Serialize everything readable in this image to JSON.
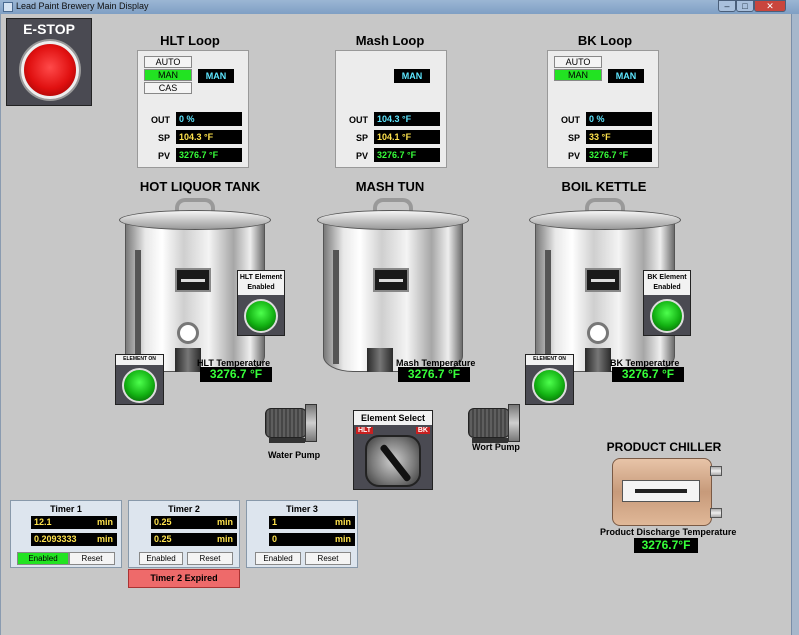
{
  "window": {
    "title": "Lead Paint Brewery Main Display",
    "min_glyph": "–",
    "max_glyph": "□",
    "close_glyph": "✕"
  },
  "estop": {
    "label": "E-STOP"
  },
  "loops": [
    {
      "title": "HLT Loop",
      "modes": [
        {
          "label": "AUTO",
          "active": false
        },
        {
          "label": "MAN",
          "active": true
        },
        {
          "label": "CAS",
          "active": false
        }
      ],
      "mode_display": "MAN",
      "out_label": "OUT",
      "out_value": "0 %",
      "sp_label": "SP",
      "sp_value": "104.3 °F",
      "pv_label": "PV",
      "pv_value": "3276.7 °F"
    },
    {
      "title": "Mash Loop",
      "modes": [],
      "mode_display": "MAN",
      "out_label": "OUT",
      "out_value": "104.3 °F",
      "sp_label": "SP",
      "sp_value": "104.1 °F",
      "pv_label": "PV",
      "pv_value": "3276.7 °F"
    },
    {
      "title": "BK Loop",
      "modes": [
        {
          "label": "AUTO",
          "active": false
        },
        {
          "label": "MAN",
          "active": true
        }
      ],
      "mode_display": "MAN",
      "out_label": "OUT",
      "out_value": "0 %",
      "sp_label": "SP",
      "sp_value": "33 °F",
      "pv_label": "PV",
      "pv_value": "3276.7 °F"
    }
  ],
  "tanks": [
    {
      "title": "HOT LIQUOR TANK",
      "temp_label": "HLT Temperature",
      "temp_value": "3276.7 °F",
      "element_on_label": "ELEMENT ON",
      "element_enabled_label": "HLT Element Enabled"
    },
    {
      "title": "MASH TUN",
      "temp_label": "Mash Temperature",
      "temp_value": "3276.7 °F"
    },
    {
      "title": "BOIL KETTLE",
      "temp_label": "BK Temperature",
      "temp_value": "3276.7 °F",
      "element_on_label": "ELEMENT ON",
      "element_enabled_label": "BK Element Enabled"
    }
  ],
  "pumps": {
    "water": "Water Pump",
    "wort": "Wort Pump"
  },
  "element_select": {
    "label": "Element Select",
    "left": "HLT",
    "right": "BK"
  },
  "chiller": {
    "title": "PRODUCT CHILLER",
    "temp_label": "Product Discharge Temperature",
    "temp_value": "3276.7°F"
  },
  "timers": [
    {
      "title": "Timer 1",
      "value": "12.1",
      "value_unit": "min",
      "elapsed": "0.2093333",
      "elapsed_unit": "min",
      "enabled_label": "Enabled",
      "enabled": true,
      "reset_label": "Reset"
    },
    {
      "title": "Timer 2",
      "value": "0.25",
      "value_unit": "min",
      "elapsed": "0.25",
      "elapsed_unit": "min",
      "enabled_label": "Enabled",
      "enabled": false,
      "reset_label": "Reset",
      "expired_label": "Timer 2 Expired"
    },
    {
      "title": "Timer 3",
      "value": "1",
      "value_unit": "min",
      "elapsed": "0",
      "elapsed_unit": "min",
      "enabled_label": "Enabled",
      "enabled": false,
      "reset_label": "Reset"
    }
  ],
  "colors": {
    "lamp_green": "#12b112",
    "estop_red": "#e01010",
    "value_cyan": "#5ee6ff",
    "value_yellow": "#ffe34d",
    "value_green": "#37ff3a",
    "expired_red": "#ee6a6a",
    "enabled_green": "#22e322"
  }
}
